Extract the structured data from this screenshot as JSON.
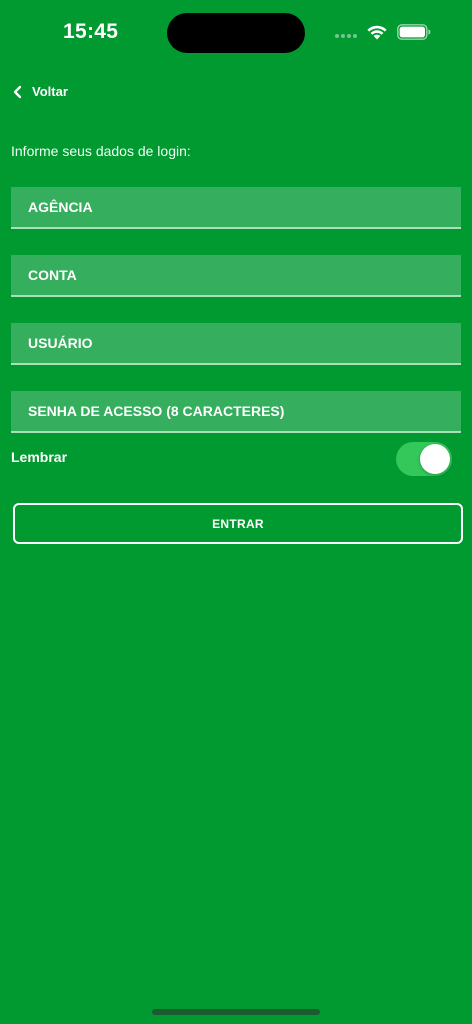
{
  "status_bar": {
    "time": "15:45"
  },
  "nav": {
    "back_label": "Voltar"
  },
  "form": {
    "intro": "Informe seus dados de login:",
    "agencia_placeholder": "AGÊNCIA",
    "conta_placeholder": "CONTA",
    "usuario_placeholder": "USUÁRIO",
    "senha_placeholder": "SENHA DE ACESSO (8 CARACTERES)",
    "remember_label": "Lembrar",
    "remember_enabled": true,
    "submit_label": "ENTRAR"
  },
  "colors": {
    "background": "#009a31",
    "field_background": "#35af5d",
    "toggle_on": "#34c759"
  }
}
